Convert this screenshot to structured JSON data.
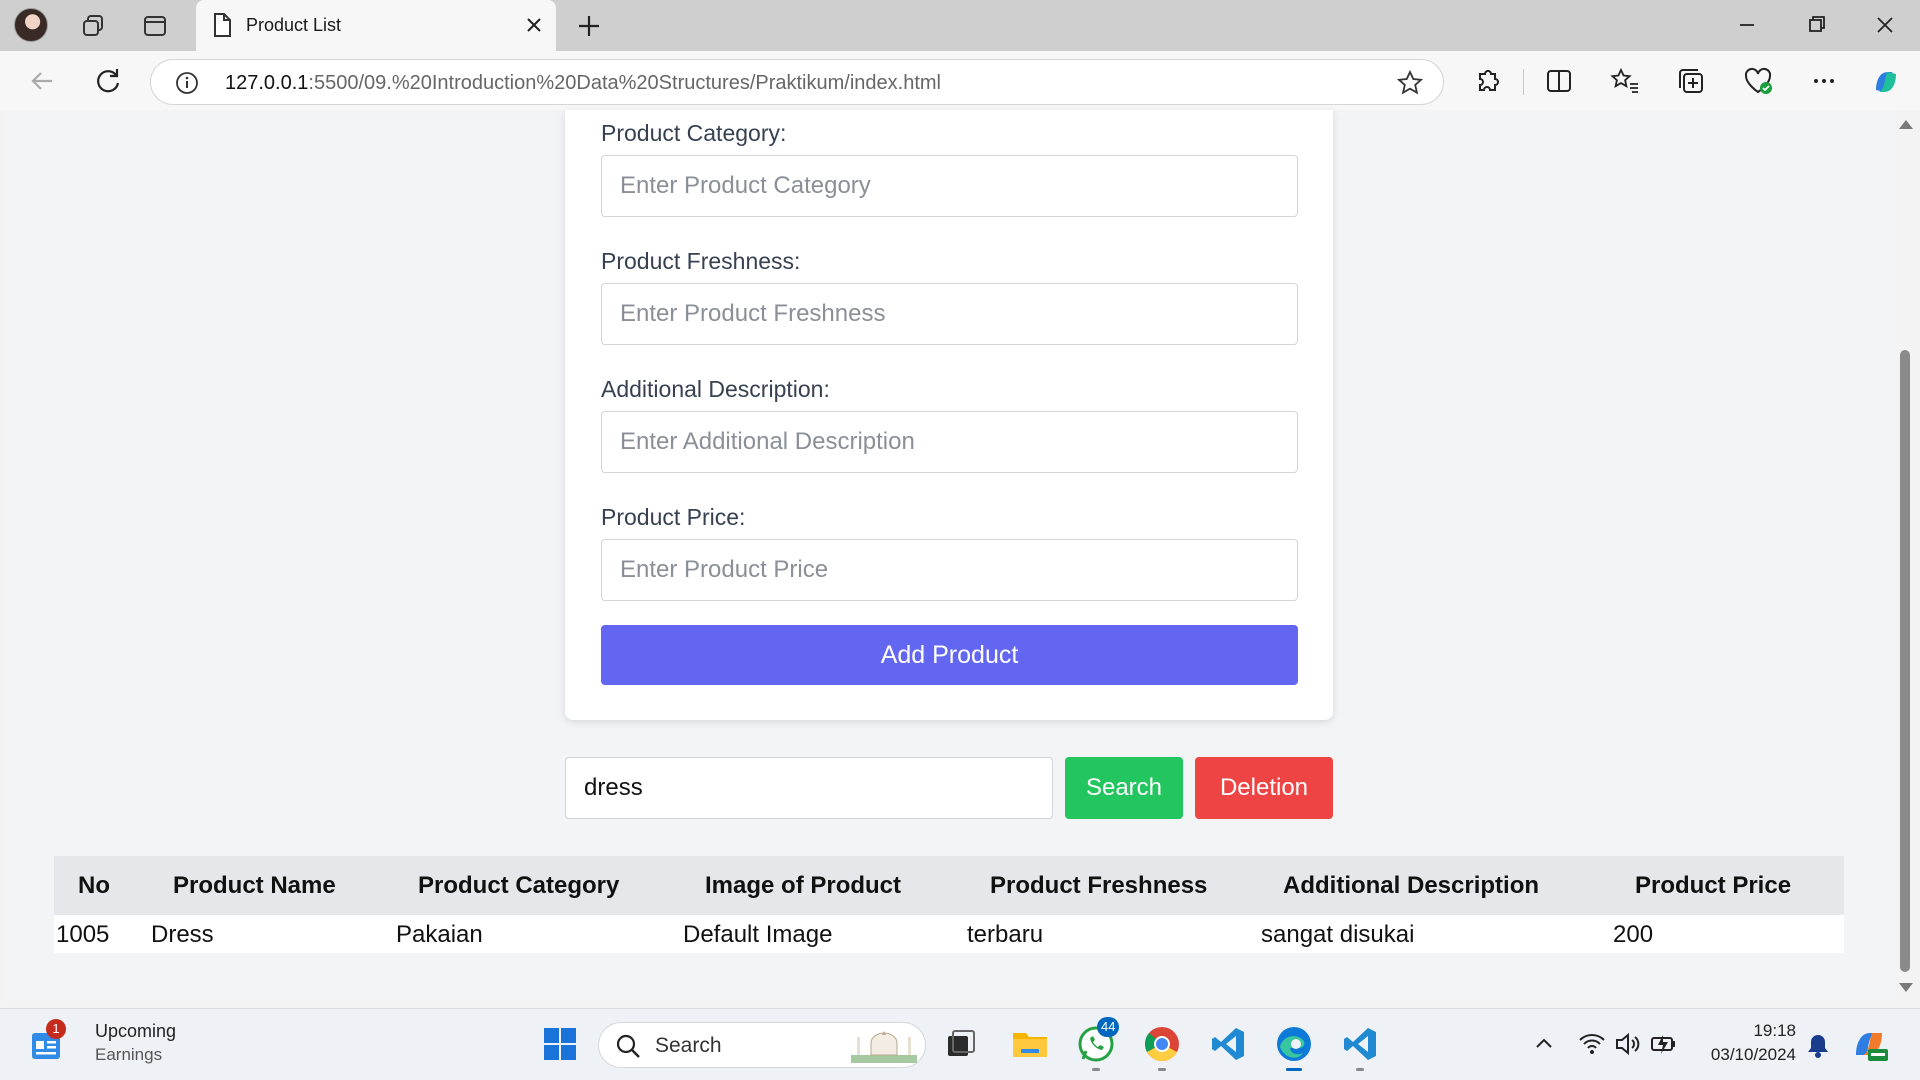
{
  "browser": {
    "tab_title": "Product List",
    "url_host": "127.0.0.1",
    "url_rest": ":5500/09.%20Introduction%20Data%20Structures/Praktikum/index.html"
  },
  "form": {
    "category_label": "Product Category:",
    "category_placeholder": "Enter Product Category",
    "freshness_label": "Product Freshness:",
    "freshness_placeholder": "Enter Product Freshness",
    "description_label": "Additional Description:",
    "description_placeholder": "Enter Additional Description",
    "price_label": "Product Price:",
    "price_placeholder": "Enter Product Price",
    "add_button": "Add Product"
  },
  "search": {
    "value": "dress",
    "search_button": "Search",
    "delete_button": "Deletion"
  },
  "table": {
    "headers": [
      "No",
      "Product Name",
      "Product Category",
      "Image of Product",
      "Product Freshness",
      "Additional Description",
      "Product Price"
    ],
    "rows": [
      [
        "1005",
        "Dress",
        "Pakaian",
        "Default Image",
        "terbaru",
        "sangat disukai",
        "200"
      ]
    ]
  },
  "taskbar": {
    "weather_title": "Upcoming",
    "weather_sub": "Earnings",
    "weather_badge": "1",
    "search_label": "Search",
    "whatsapp_badge": "44",
    "time": "19:18",
    "date": "03/10/2024"
  },
  "colors": {
    "add_button": "#6366f1",
    "search_button": "#22c55e",
    "delete_button": "#ef4444",
    "table_header": "#e5e7eb"
  }
}
